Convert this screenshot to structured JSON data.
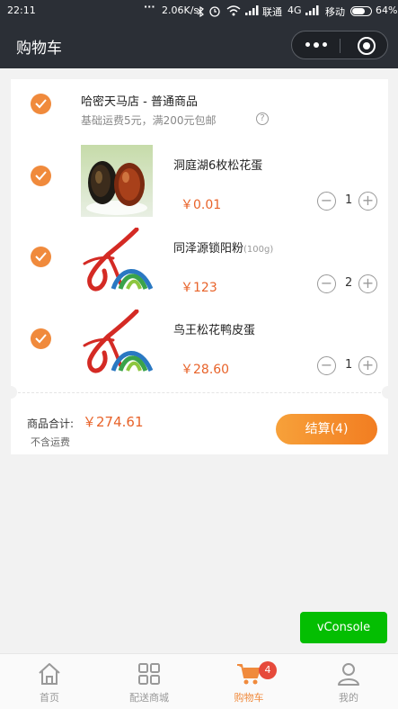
{
  "status_bar": {
    "time": "22:11",
    "speed": "2.06K/s",
    "carrier1": "联通",
    "network": "4G",
    "carrier2": "移动",
    "battery": "64%"
  },
  "navbar": {
    "title": "购物车"
  },
  "cart": {
    "shop_name": "哈密天马店 - 普通商品",
    "shipping_note": "基础运费5元，满200元包邮",
    "help_glyph": "?",
    "items": [
      {
        "name": "洞庭湖6枚松花蛋",
        "spec": "",
        "price": "￥0.01",
        "qty": "1",
        "image": "preserved-egg-photo"
      },
      {
        "name": "同泽源锁阳粉",
        "spec": "(100g)",
        "price": "￥123",
        "qty": "2",
        "image": "brand-logo"
      },
      {
        "name": "鸟王松花鸭皮蛋",
        "spec": "",
        "price": "￥28.60",
        "qty": "1",
        "image": "brand-logo"
      }
    ],
    "minus_glyph": "−",
    "plus_glyph": "+",
    "total_label": "商品合计:",
    "total_value": "￥274.61",
    "no_shipping_note": "不含运费",
    "checkout_label": "结算(4)"
  },
  "vconsole": {
    "label": "vConsole"
  },
  "tabbar": {
    "tabs": [
      {
        "label": "首页",
        "icon": "home-icon"
      },
      {
        "label": "配送商城",
        "icon": "grid-icon"
      },
      {
        "label": "购物车",
        "icon": "cart-icon",
        "badge": "4",
        "active": true
      },
      {
        "label": "我的",
        "icon": "user-icon"
      }
    ]
  },
  "colors": {
    "accent": "#f08a3c",
    "price": "#e8632a",
    "badge": "#e64a3b",
    "vconsole": "#04be02",
    "header": "#2b2f36"
  }
}
